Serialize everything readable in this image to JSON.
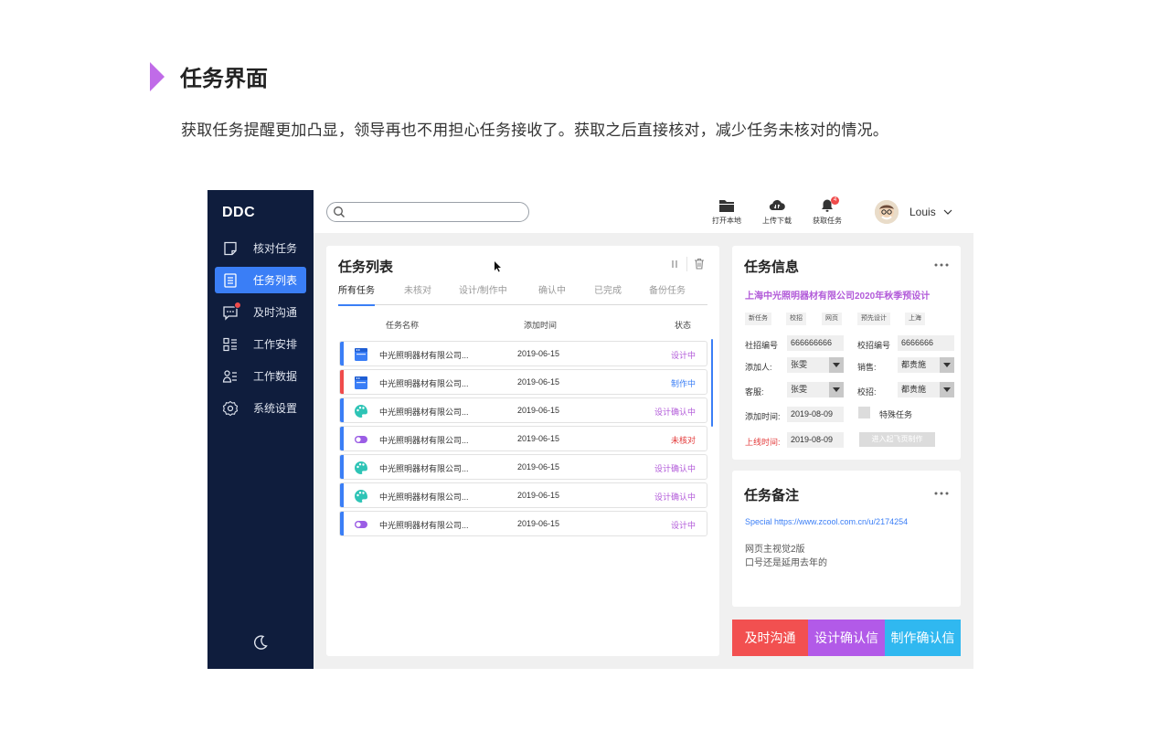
{
  "page": {
    "heading": "任务界面",
    "description": "获取任务提醒更加凸显，领导再也不用担心任务接收了。获取之后直接核对，减少任务未核对的情况。"
  },
  "sidebar": {
    "brand": "DDC",
    "items": [
      {
        "label": "核对任务",
        "icon": "note-icon"
      },
      {
        "label": "任务列表",
        "icon": "document-list-icon",
        "active": true
      },
      {
        "label": "及时沟通",
        "icon": "chat-icon",
        "badge": true
      },
      {
        "label": "工作安排",
        "icon": "schedule-icon"
      },
      {
        "label": "工作数据",
        "icon": "user-data-icon"
      },
      {
        "label": "系统设置",
        "icon": "gear-icon"
      }
    ],
    "theme_icon": "moon-icon"
  },
  "topbar": {
    "search_placeholder": "",
    "tools": [
      {
        "label": "打开本地",
        "icon": "folder-icon"
      },
      {
        "label": "上传下载",
        "icon": "cloud-icon"
      },
      {
        "label": "获取任务",
        "icon": "bell-icon",
        "badge": "4"
      }
    ],
    "user_name": "Louis"
  },
  "task_list": {
    "title": "任务列表",
    "tabs": [
      "所有任务",
      "未核对",
      "设计/制作中",
      "确认中",
      "已完成",
      "备份任务"
    ],
    "columns": [
      "任务名称",
      "添加时间",
      "状态"
    ],
    "rows": [
      {
        "name": "中光照明器材有限公司...",
        "date": "2019-06-15",
        "status": "设计中",
        "status_color": "#b25ad9",
        "stripe": "#3a7ef6",
        "icon": "browser-window-icon",
        "icon_color": "#3a7ef6"
      },
      {
        "name": "中光照明器材有限公司...",
        "date": "2019-06-15",
        "status": "制作中",
        "status_color": "#3a7ef6",
        "stripe": "#f04b4b",
        "icon": "browser-window-icon",
        "icon_color": "#3a7ef6"
      },
      {
        "name": "中光照明器材有限公司...",
        "date": "2019-06-15",
        "status": "设计确认中",
        "status_color": "#b25ad9",
        "stripe": "#3a7ef6",
        "icon": "palette-icon",
        "icon_color": "#2ec4b6"
      },
      {
        "name": "中光照明器材有限公司...",
        "date": "2019-06-15",
        "status": "未核对",
        "status_color": "#e33b3b",
        "stripe": "#3a7ef6",
        "icon": "toggle-icon",
        "icon_color": "#9b5de5"
      },
      {
        "name": "中光照明器材有限公司...",
        "date": "2019-06-15",
        "status": "设计确认中",
        "status_color": "#b25ad9",
        "stripe": "#3a7ef6",
        "icon": "palette-icon",
        "icon_color": "#2ec4b6"
      },
      {
        "name": "中光照明器材有限公司...",
        "date": "2019-06-15",
        "status": "设计确认中",
        "status_color": "#b25ad9",
        "stripe": "#3a7ef6",
        "icon": "palette-icon",
        "icon_color": "#2ec4b6"
      },
      {
        "name": "中光照明器材有限公司...",
        "date": "2019-06-15",
        "status": "设计中",
        "status_color": "#b25ad9",
        "stripe": "#3a7ef6",
        "icon": "toggle-icon",
        "icon_color": "#9b5de5"
      }
    ]
  },
  "task_info": {
    "title": "任务信息",
    "company": "上海中光照明器材有限公司2020年秋季预设计",
    "tags": [
      "新任务",
      "校招",
      "网页",
      "预先设计",
      "上海"
    ],
    "fields": {
      "social_no_label": "社招编号",
      "social_no_value": "666666666",
      "campus_no_label": "校招编号",
      "campus_no_value": "6666666",
      "adder_label": "添加人:",
      "adder_value": "张雯",
      "sales_label": "销售:",
      "sales_value": "都贵施",
      "service_label": "客服:",
      "service_value": "张雯",
      "campus_label": "校招:",
      "campus_value": "都贵施",
      "add_time_label": "添加时间:",
      "add_time_value": "2019-08-09",
      "online_time_label": "上线时间:",
      "online_time_value": "2019-08-09"
    },
    "special_task_label": "特殊任务",
    "enter_button": "进入起飞页制作"
  },
  "task_notes": {
    "title": "任务备注",
    "link": "Special  https://www.zcool.com.cn/u/2174254",
    "lines": [
      "网页主视觉2版",
      "口号还是延用去年的"
    ]
  },
  "actions": [
    {
      "label": "及时沟通",
      "color": "#f25050"
    },
    {
      "label": "设计确认信",
      "color": "#b25ae8"
    },
    {
      "label": "制作确认信",
      "color": "#30b8f0"
    }
  ],
  "colors": {
    "sidebar_bg": "#0f1d3d",
    "accent_blue": "#3a7ef6",
    "accent_purple": "#b25ad9",
    "danger_red": "#e33b3b",
    "heading_marker": "#c06be8"
  }
}
